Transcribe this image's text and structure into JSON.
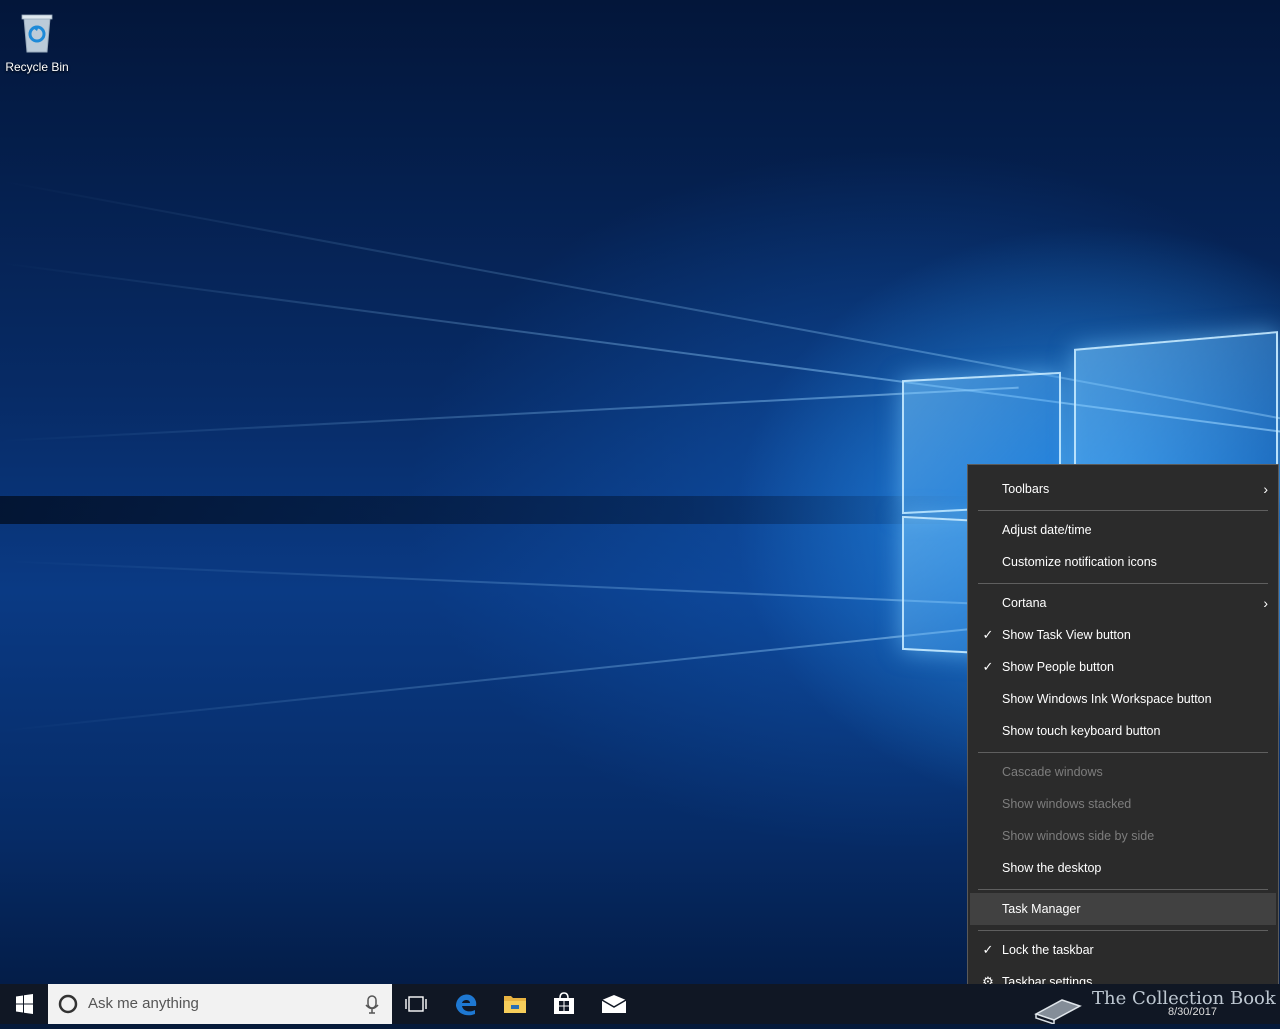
{
  "desktop": {
    "icons": [
      {
        "label": "Recycle Bin",
        "icon": "recycle-bin-icon"
      }
    ]
  },
  "context_menu": {
    "items": [
      {
        "label": "Toolbars",
        "submenu": true
      },
      {
        "label": "Adjust date/time"
      },
      {
        "label": "Customize notification icons"
      },
      {
        "label": "Cortana",
        "submenu": true
      },
      {
        "label": "Show Task View button",
        "checked": true
      },
      {
        "label": "Show People button",
        "checked": true
      },
      {
        "label": "Show Windows Ink Workspace button"
      },
      {
        "label": "Show touch keyboard button"
      },
      {
        "label": "Cascade windows",
        "disabled": true
      },
      {
        "label": "Show windows stacked",
        "disabled": true
      },
      {
        "label": "Show windows side by side",
        "disabled": true
      },
      {
        "label": "Show the desktop"
      },
      {
        "label": "Task Manager",
        "highlighted": true
      },
      {
        "label": "Lock the taskbar",
        "checked": true
      },
      {
        "label": "Taskbar settings",
        "icon": "gear-icon"
      }
    ]
  },
  "taskbar": {
    "search_placeholder": "Ask me anything",
    "date": "8/30/2017",
    "pinned": [
      "task-view-icon",
      "edge-icon",
      "file-explorer-icon",
      "store-icon",
      "mail-icon"
    ]
  },
  "watermark": {
    "text": "The Collection Book"
  },
  "colors": {
    "menu_bg": "#2b2b2b",
    "menu_highlight": "#414141",
    "taskbar_bg": "#101724",
    "edge_blue": "#1e78d2"
  }
}
